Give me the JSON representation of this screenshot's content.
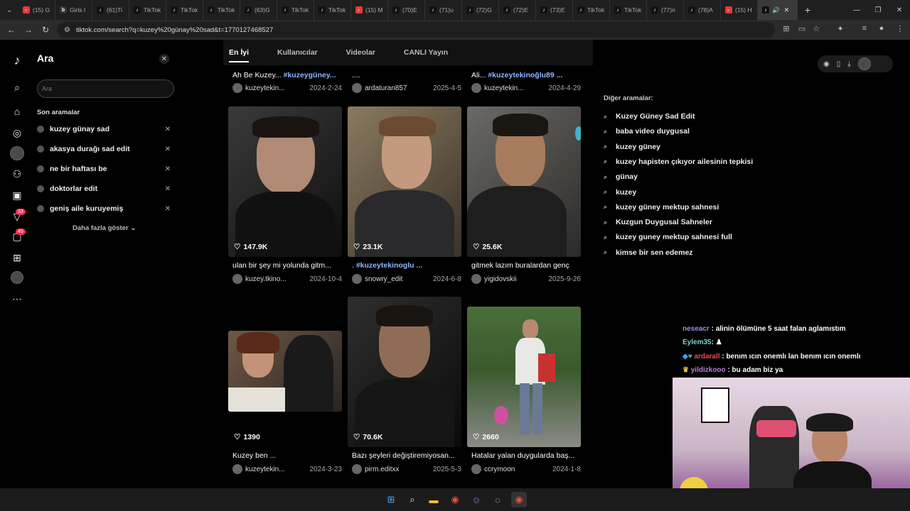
{
  "browser": {
    "tabs": [
      {
        "label": "(15) G",
        "icon": "youtube"
      },
      {
        "label": "Girls I",
        "icon": "gmail"
      },
      {
        "label": "(61)Ti",
        "icon": "tiktok"
      },
      {
        "label": "TikTok",
        "icon": "tiktok"
      },
      {
        "label": "TikTok",
        "icon": "tiktok"
      },
      {
        "label": "TikTok",
        "icon": "tiktok"
      },
      {
        "label": "(63)G",
        "icon": "tiktok"
      },
      {
        "label": "TikTok",
        "icon": "tiktok"
      },
      {
        "label": "TikTok",
        "icon": "tiktok"
      },
      {
        "label": "(15) M",
        "icon": "youtube"
      },
      {
        "label": "(70)E",
        "icon": "tiktok"
      },
      {
        "label": "(71)u",
        "icon": "tiktok"
      },
      {
        "label": "(72)G",
        "icon": "tiktok"
      },
      {
        "label": "(72)E",
        "icon": "tiktok"
      },
      {
        "label": "(73)E",
        "icon": "tiktok"
      },
      {
        "label": "TikTok",
        "icon": "tiktok"
      },
      {
        "label": "TikTok",
        "icon": "tiktok"
      },
      {
        "label": "(77)n",
        "icon": "tiktok"
      },
      {
        "label": "(78)A",
        "icon": "tiktok"
      },
      {
        "label": "(15) H",
        "icon": "youtube"
      }
    ],
    "url": "tiktok.com/search?q=kuzey%20günay%20sad&t=1770127468527",
    "new_tab_symbol": "+"
  },
  "search_panel": {
    "title": "Ara",
    "input_placeholder": "Ara",
    "recent_title": "Son aramalar",
    "recent": [
      "kuzey günay sad",
      "akasya durağı sad edit",
      "ne bir haftası be",
      "doktorlar edit",
      "geniş aile kuruyemiş"
    ],
    "more_label": "Daha fazla göster"
  },
  "sidebar": {
    "inbox_badge": "33",
    "messages_badge": "45"
  },
  "tabs": [
    "En İyi",
    "Kullanıcılar",
    "Videolar",
    "CANLI Yayın"
  ],
  "top_row": [
    {
      "caption": "Ah Be Kuzey...",
      "tag": "#kuzeygüney...",
      "user": "kuzeytekin...",
      "date": "2024-2-24"
    },
    {
      "caption": "....",
      "tag": "",
      "user": "ardaturan857",
      "date": "2025-4-5"
    },
    {
      "caption": "Ali...",
      "tag": "#kuzeytekinoğlu89 ...",
      "user": "kuzeytekin...",
      "date": "2024-4-29"
    }
  ],
  "videos": [
    {
      "likes": "147.9K",
      "caption": "ulan bir şey mi yolunda gitm...",
      "tag": "",
      "user": "kuzey.tkino...",
      "date": "2024-10-4"
    },
    {
      "likes": "23.1K",
      "caption": ". ",
      "tag": "#kuzeytekinoglu ...",
      "user": "snowry_edit",
      "date": "2024-6-8"
    },
    {
      "likes": "25.6K",
      "caption": "gitmek lazım buralardan genç",
      "tag": "",
      "user": "yigidovskii",
      "date": "2025-9-26"
    },
    {
      "likes": "1390",
      "caption": "Kuzey ben ...",
      "tag": "",
      "user": "kuzeytekin...",
      "date": "2024-3-23"
    },
    {
      "likes": "70.6K",
      "caption": "Bazı şeyleri değiştiremiyosan...",
      "tag": "",
      "user": "pirm.editxx",
      "date": "2025-5-3"
    },
    {
      "likes": "2660",
      "caption": "Hatalar yalan duygularda baş...",
      "tag": "",
      "user": "ccrymoon",
      "date": "2024-1-8"
    }
  ],
  "others": {
    "title": "Diğer aramalar:",
    "items": [
      "Kuzey Güney Sad Edit",
      "baba video duygusal",
      "kuzey güney",
      "kuzey hapisten çıkıyor ailesinin tepkisi",
      "günay",
      "kuzey",
      "kuzey güney mektup sahnesi",
      "Kuzgun Duygusal Sahneler",
      "kuzey guney mektup sahnesi full",
      "kimse bir sen edemez"
    ]
  },
  "chat": [
    {
      "name": "neseacr",
      "text": ": alinin ölümüne 5 saat falan aglamıstım"
    },
    {
      "name": "Eylem35",
      "text": ":"
    },
    {
      "name": "ardarall",
      "text": ": benım ıcın onemlı lan benım ıcın onemlı"
    },
    {
      "name": "yildizkooo",
      "text": ": bu adam biz ya"
    }
  ],
  "colors": {
    "accent": "#fe2c55",
    "hashtag": "#8fb8ff",
    "background": "#000000"
  }
}
